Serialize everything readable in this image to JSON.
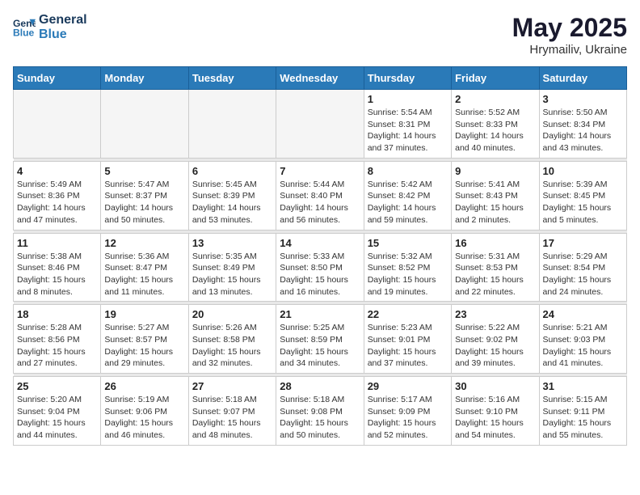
{
  "header": {
    "logo_line1": "General",
    "logo_line2": "Blue",
    "month_year": "May 2025",
    "location": "Hrymailiv, Ukraine"
  },
  "days_of_week": [
    "Sunday",
    "Monday",
    "Tuesday",
    "Wednesday",
    "Thursday",
    "Friday",
    "Saturday"
  ],
  "weeks": [
    {
      "days": [
        {
          "num": "",
          "info": ""
        },
        {
          "num": "",
          "info": ""
        },
        {
          "num": "",
          "info": ""
        },
        {
          "num": "",
          "info": ""
        },
        {
          "num": "1",
          "info": "Sunrise: 5:54 AM\nSunset: 8:31 PM\nDaylight: 14 hours\nand 37 minutes."
        },
        {
          "num": "2",
          "info": "Sunrise: 5:52 AM\nSunset: 8:33 PM\nDaylight: 14 hours\nand 40 minutes."
        },
        {
          "num": "3",
          "info": "Sunrise: 5:50 AM\nSunset: 8:34 PM\nDaylight: 14 hours\nand 43 minutes."
        }
      ]
    },
    {
      "days": [
        {
          "num": "4",
          "info": "Sunrise: 5:49 AM\nSunset: 8:36 PM\nDaylight: 14 hours\nand 47 minutes."
        },
        {
          "num": "5",
          "info": "Sunrise: 5:47 AM\nSunset: 8:37 PM\nDaylight: 14 hours\nand 50 minutes."
        },
        {
          "num": "6",
          "info": "Sunrise: 5:45 AM\nSunset: 8:39 PM\nDaylight: 14 hours\nand 53 minutes."
        },
        {
          "num": "7",
          "info": "Sunrise: 5:44 AM\nSunset: 8:40 PM\nDaylight: 14 hours\nand 56 minutes."
        },
        {
          "num": "8",
          "info": "Sunrise: 5:42 AM\nSunset: 8:42 PM\nDaylight: 14 hours\nand 59 minutes."
        },
        {
          "num": "9",
          "info": "Sunrise: 5:41 AM\nSunset: 8:43 PM\nDaylight: 15 hours\nand 2 minutes."
        },
        {
          "num": "10",
          "info": "Sunrise: 5:39 AM\nSunset: 8:45 PM\nDaylight: 15 hours\nand 5 minutes."
        }
      ]
    },
    {
      "days": [
        {
          "num": "11",
          "info": "Sunrise: 5:38 AM\nSunset: 8:46 PM\nDaylight: 15 hours\nand 8 minutes."
        },
        {
          "num": "12",
          "info": "Sunrise: 5:36 AM\nSunset: 8:47 PM\nDaylight: 15 hours\nand 11 minutes."
        },
        {
          "num": "13",
          "info": "Sunrise: 5:35 AM\nSunset: 8:49 PM\nDaylight: 15 hours\nand 13 minutes."
        },
        {
          "num": "14",
          "info": "Sunrise: 5:33 AM\nSunset: 8:50 PM\nDaylight: 15 hours\nand 16 minutes."
        },
        {
          "num": "15",
          "info": "Sunrise: 5:32 AM\nSunset: 8:52 PM\nDaylight: 15 hours\nand 19 minutes."
        },
        {
          "num": "16",
          "info": "Sunrise: 5:31 AM\nSunset: 8:53 PM\nDaylight: 15 hours\nand 22 minutes."
        },
        {
          "num": "17",
          "info": "Sunrise: 5:29 AM\nSunset: 8:54 PM\nDaylight: 15 hours\nand 24 minutes."
        }
      ]
    },
    {
      "days": [
        {
          "num": "18",
          "info": "Sunrise: 5:28 AM\nSunset: 8:56 PM\nDaylight: 15 hours\nand 27 minutes."
        },
        {
          "num": "19",
          "info": "Sunrise: 5:27 AM\nSunset: 8:57 PM\nDaylight: 15 hours\nand 29 minutes."
        },
        {
          "num": "20",
          "info": "Sunrise: 5:26 AM\nSunset: 8:58 PM\nDaylight: 15 hours\nand 32 minutes."
        },
        {
          "num": "21",
          "info": "Sunrise: 5:25 AM\nSunset: 8:59 PM\nDaylight: 15 hours\nand 34 minutes."
        },
        {
          "num": "22",
          "info": "Sunrise: 5:23 AM\nSunset: 9:01 PM\nDaylight: 15 hours\nand 37 minutes."
        },
        {
          "num": "23",
          "info": "Sunrise: 5:22 AM\nSunset: 9:02 PM\nDaylight: 15 hours\nand 39 minutes."
        },
        {
          "num": "24",
          "info": "Sunrise: 5:21 AM\nSunset: 9:03 PM\nDaylight: 15 hours\nand 41 minutes."
        }
      ]
    },
    {
      "days": [
        {
          "num": "25",
          "info": "Sunrise: 5:20 AM\nSunset: 9:04 PM\nDaylight: 15 hours\nand 44 minutes."
        },
        {
          "num": "26",
          "info": "Sunrise: 5:19 AM\nSunset: 9:06 PM\nDaylight: 15 hours\nand 46 minutes."
        },
        {
          "num": "27",
          "info": "Sunrise: 5:18 AM\nSunset: 9:07 PM\nDaylight: 15 hours\nand 48 minutes."
        },
        {
          "num": "28",
          "info": "Sunrise: 5:18 AM\nSunset: 9:08 PM\nDaylight: 15 hours\nand 50 minutes."
        },
        {
          "num": "29",
          "info": "Sunrise: 5:17 AM\nSunset: 9:09 PM\nDaylight: 15 hours\nand 52 minutes."
        },
        {
          "num": "30",
          "info": "Sunrise: 5:16 AM\nSunset: 9:10 PM\nDaylight: 15 hours\nand 54 minutes."
        },
        {
          "num": "31",
          "info": "Sunrise: 5:15 AM\nSunset: 9:11 PM\nDaylight: 15 hours\nand 55 minutes."
        }
      ]
    }
  ]
}
